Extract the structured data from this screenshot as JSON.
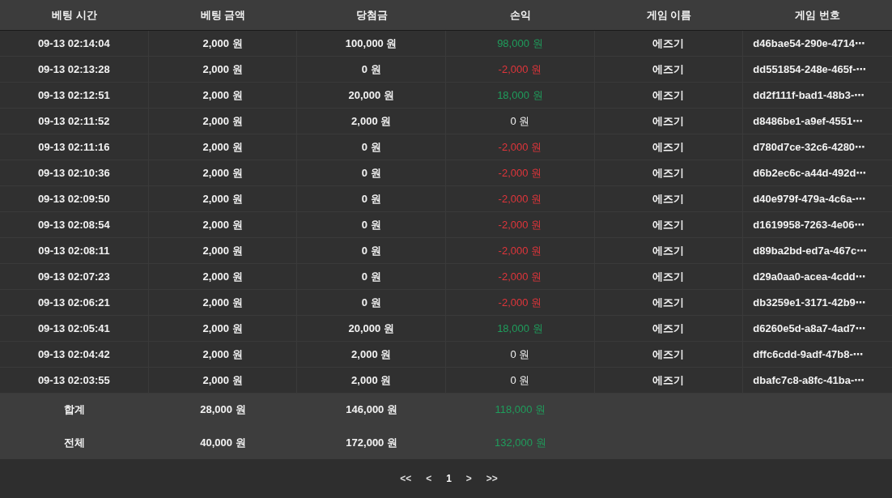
{
  "table": {
    "columns": [
      "베팅 시간",
      "베팅 금액",
      "당첨금",
      "손익",
      "게임 이름",
      "게임 번호"
    ],
    "rows": [
      {
        "time": "09-13 02:14:04",
        "bet": "2,000 원",
        "payout": "100,000 원",
        "profit": "98,000 원",
        "color": "#1f9d5c",
        "game": "에즈기",
        "game_id": "d46bae54-290e-4714⋯"
      },
      {
        "time": "09-13 02:13:28",
        "bet": "2,000 원",
        "payout": "0 원",
        "profit": "-2,000 원",
        "color": "#e0353b",
        "game": "에즈기",
        "game_id": "dd551854-248e-465f-⋯"
      },
      {
        "time": "09-13 02:12:51",
        "bet": "2,000 원",
        "payout": "20,000 원",
        "profit": "18,000 원",
        "color": "#1f9d5c",
        "game": "에즈기",
        "game_id": "dd2f111f-bad1-48b3-⋯"
      },
      {
        "time": "09-13 02:11:52",
        "bet": "2,000 원",
        "payout": "2,000 원",
        "profit": "0 원",
        "color": "#f2f2f2",
        "game": "에즈기",
        "game_id": "d8486be1-a9ef-4551⋯"
      },
      {
        "time": "09-13 02:11:16",
        "bet": "2,000 원",
        "payout": "0 원",
        "profit": "-2,000 원",
        "color": "#e0353b",
        "game": "에즈기",
        "game_id": "d780d7ce-32c6-4280⋯"
      },
      {
        "time": "09-13 02:10:36",
        "bet": "2,000 원",
        "payout": "0 원",
        "profit": "-2,000 원",
        "color": "#e0353b",
        "game": "에즈기",
        "game_id": "d6b2ec6c-a44d-492d⋯"
      },
      {
        "time": "09-13 02:09:50",
        "bet": "2,000 원",
        "payout": "0 원",
        "profit": "-2,000 원",
        "color": "#e0353b",
        "game": "에즈기",
        "game_id": "d40e979f-479a-4c6a-⋯"
      },
      {
        "time": "09-13 02:08:54",
        "bet": "2,000 원",
        "payout": "0 원",
        "profit": "-2,000 원",
        "color": "#e0353b",
        "game": "에즈기",
        "game_id": "d1619958-7263-4e06⋯"
      },
      {
        "time": "09-13 02:08:11",
        "bet": "2,000 원",
        "payout": "0 원",
        "profit": "-2,000 원",
        "color": "#e0353b",
        "game": "에즈기",
        "game_id": "d89ba2bd-ed7a-467c⋯"
      },
      {
        "time": "09-13 02:07:23",
        "bet": "2,000 원",
        "payout": "0 원",
        "profit": "-2,000 원",
        "color": "#e0353b",
        "game": "에즈기",
        "game_id": "d29a0aa0-acea-4cdd⋯"
      },
      {
        "time": "09-13 02:06:21",
        "bet": "2,000 원",
        "payout": "0 원",
        "profit": "-2,000 원",
        "color": "#e0353b",
        "game": "에즈기",
        "game_id": "db3259e1-3171-42b9⋯"
      },
      {
        "time": "09-13 02:05:41",
        "bet": "2,000 원",
        "payout": "20,000 원",
        "profit": "18,000 원",
        "color": "#1f9d5c",
        "game": "에즈기",
        "game_id": "d6260e5d-a8a7-4ad7⋯"
      },
      {
        "time": "09-13 02:04:42",
        "bet": "2,000 원",
        "payout": "2,000 원",
        "profit": "0 원",
        "color": "#f2f2f2",
        "game": "에즈기",
        "game_id": "dffc6cdd-9adf-47b8-⋯"
      },
      {
        "time": "09-13 02:03:55",
        "bet": "2,000 원",
        "payout": "2,000 원",
        "profit": "0 원",
        "color": "#f2f2f2",
        "game": "에즈기",
        "game_id": "dbafc7c8-a8fc-41ba-⋯"
      }
    ],
    "totals": [
      {
        "label": "합계",
        "bet": "28,000 원",
        "payout": "146,000 원",
        "profit": "118,000 원",
        "color": "#1f9d5c"
      },
      {
        "label": "전체",
        "bet": "40,000 원",
        "payout": "172,000 원",
        "profit": "132,000 원",
        "color": "#1f9d5c"
      }
    ]
  },
  "pagination": {
    "first": "<<",
    "prev": "<",
    "pages": [
      {
        "label": "1",
        "selected": true
      }
    ],
    "next": ">",
    "last": ">>"
  }
}
